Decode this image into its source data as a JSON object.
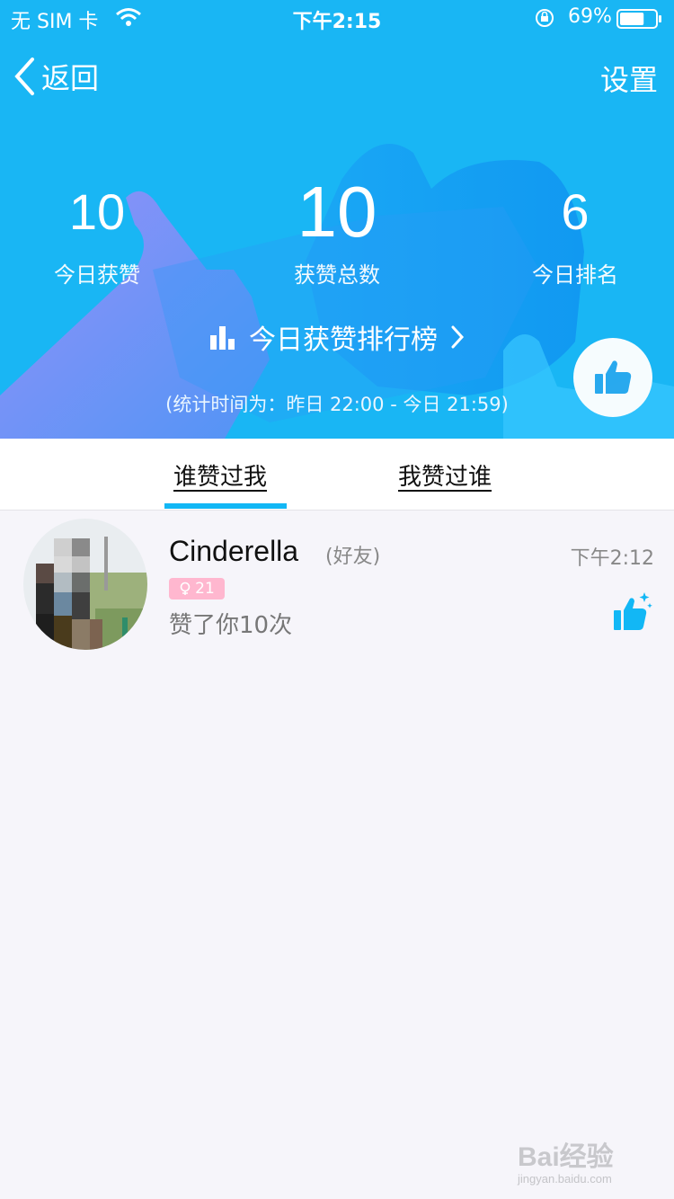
{
  "status_bar": {
    "carrier": "无 SIM 卡",
    "time": "下午2:15",
    "battery": "69%",
    "battery_level": 0.69
  },
  "nav": {
    "back_label": "返回",
    "settings_label": "设置"
  },
  "stats": {
    "today_likes": {
      "value": "10",
      "label": "今日获赞"
    },
    "total_likes": {
      "value": "10",
      "label": "获赞总数"
    },
    "today_rank": {
      "value": "6",
      "label": "今日排名"
    }
  },
  "ranking_link": "今日获赞排行榜",
  "stat_period": "(统计时间为：昨日 22:00 - 今日 21:59)",
  "tabs": [
    {
      "label": "谁赞过我",
      "active": true
    },
    {
      "label": "我赞过谁",
      "active": false
    }
  ],
  "list": [
    {
      "name": "Cinderella",
      "relation": "(好友)",
      "badge_age": "21",
      "description": "赞了你10次",
      "time": "下午2:12"
    }
  ],
  "watermark": {
    "text": "Bai经验",
    "sub": "jingyan.baidu.com"
  },
  "colors": {
    "header_blue": "#19b6f4",
    "accent": "#12b7f5",
    "badge_pink": "#ffb7cf"
  }
}
